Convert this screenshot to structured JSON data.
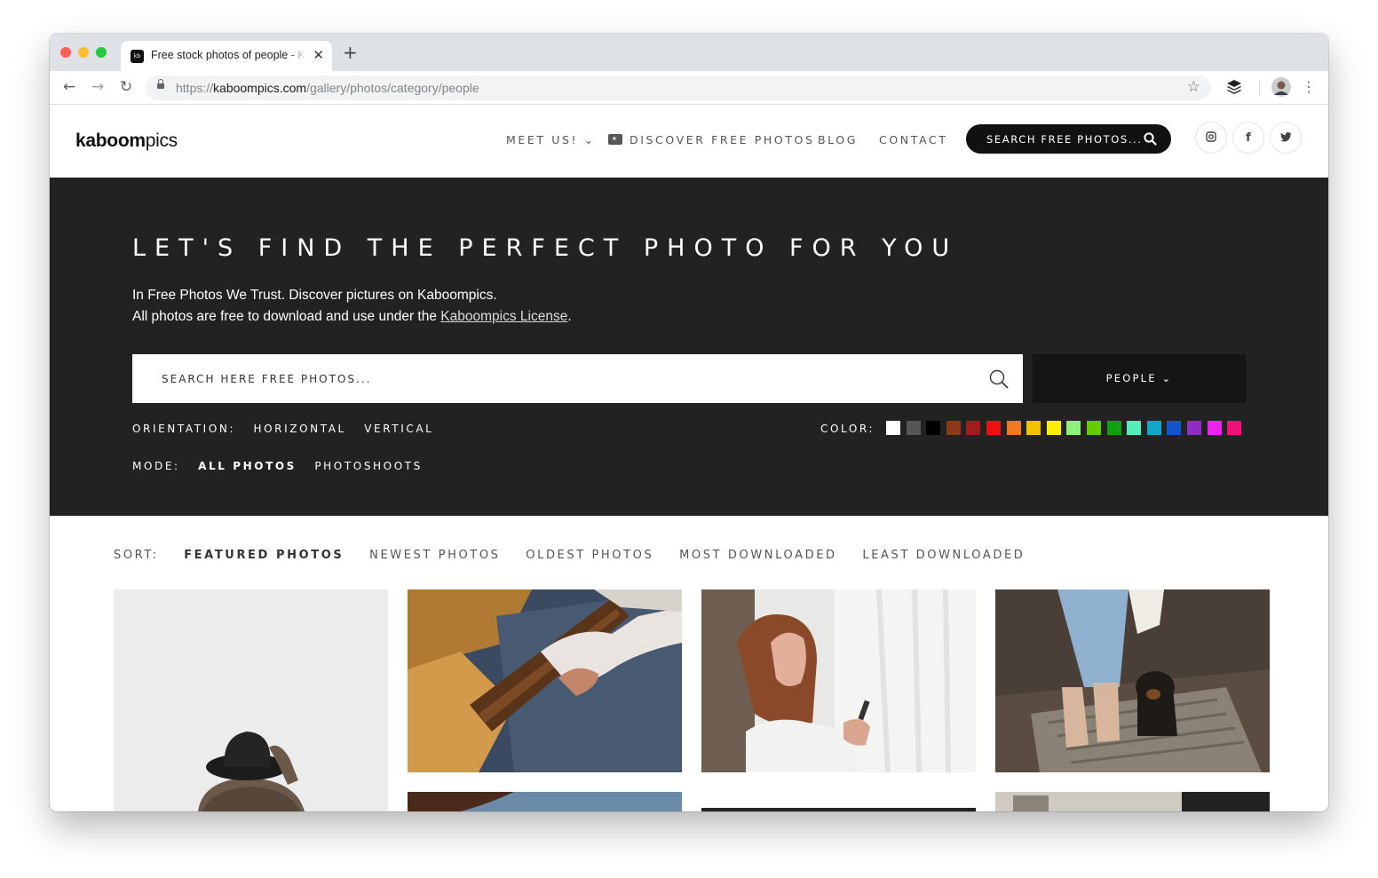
{
  "browser": {
    "tab_title": "Free stock photos of people - Kaboompics",
    "favicon_text": "kb",
    "url_scheme": "https://",
    "url_domain": "kaboompics.com",
    "url_path": "/gallery/photos/category/people"
  },
  "header": {
    "logo_bold": "kaboom",
    "logo_light": "pics",
    "nav": {
      "meet_us": "MEET US! ⌄",
      "discover": "DISCOVER FREE PHOTOS",
      "blog": "BLOG",
      "contact": "CONTACT"
    },
    "search_label": "SEARCH FREE PHOTOS...",
    "social_icons": [
      "instagram-icon",
      "facebook-icon",
      "twitter-icon"
    ]
  },
  "hero": {
    "title": "LET'S FIND THE PERFECT PHOTO FOR YOU",
    "line1": "In Free Photos We Trust. Discover pictures on Kaboompics.",
    "line2_prefix": "All photos are free to download and use under the ",
    "license_link": "Kaboompics License",
    "line2_suffix": ".",
    "search_placeholder": "SEARCH HERE FREE PHOTOS...",
    "category": "PEOPLE ⌄",
    "orientation_label": "ORIENTATION:",
    "orientation_horizontal": "HORIZONTAL",
    "orientation_vertical": "VERTICAL",
    "color_label": "COLOR:",
    "colors": [
      "#ffffff",
      "#555555",
      "#000000",
      "#8b3a1a",
      "#a11c1c",
      "#ee1111",
      "#f07820",
      "#f5c000",
      "#ffee00",
      "#8ef27a",
      "#66cc00",
      "#11a011",
      "#55eebb",
      "#11a6c8",
      "#1155cc",
      "#8e2cc4",
      "#ee22ee",
      "#ee1177"
    ],
    "mode_label": "MODE:",
    "mode_all": "ALL PHOTOS",
    "mode_photoshoots": "PHOTOSHOOTS"
  },
  "sort": {
    "label": "SORT:",
    "options": [
      "FEATURED PHOTOS",
      "NEWEST PHOTOS",
      "OLDEST PHOTOS",
      "MOST DOWNLOADED",
      "LEAST DOWNLOADED"
    ],
    "active": "FEATURED PHOTOS"
  }
}
